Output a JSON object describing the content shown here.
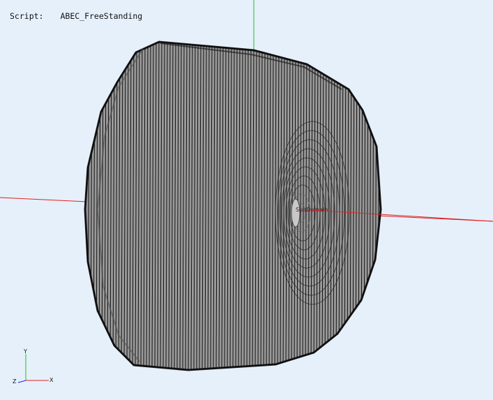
{
  "hud": {
    "script_label": "Script:",
    "script_name": "ABEC_FreeStanding"
  },
  "scene": {
    "mesh_label": "SubDomain",
    "colors": {
      "background": "#e6f0fb",
      "mesh_fill": "#9a9a9a",
      "mesh_lines": "#000000",
      "axis_x": "#e02020",
      "axis_y": "#20c020",
      "axis_z": "#2020e0"
    }
  },
  "triad": {
    "x": "X",
    "y": "Y",
    "z": "Z"
  }
}
